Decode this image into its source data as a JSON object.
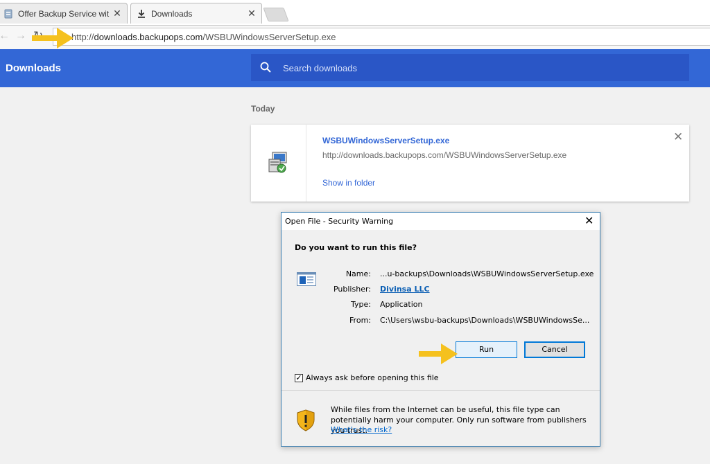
{
  "browser": {
    "tabs": [
      {
        "label": "Offer Backup Service wit",
        "icon": "page-icon",
        "active": false
      },
      {
        "label": "Downloads",
        "icon": "download-icon",
        "active": true
      }
    ],
    "url_prefix": "http://",
    "url_host": "downloads.backupops.com",
    "url_path": "/WSBUWindowsServerSetup.exe"
  },
  "downloads_page": {
    "title": "Downloads",
    "search_placeholder": "Search downloads",
    "date_heading": "Today",
    "item": {
      "file_name": "WSBUWindowsServerSetup.exe",
      "url": "http://downloads.backupops.com/WSBUWindowsServerSetup.exe",
      "action_label": "Show in folder"
    }
  },
  "dialog": {
    "title": "Open File - Security Warning",
    "question": "Do you want to run this file?",
    "fields": [
      {
        "label": "Name:",
        "value": "...u-backups\\Downloads\\WSBUWindowsServerSetup.exe"
      },
      {
        "label": "Publisher:",
        "value": "Divinsa LLC"
      },
      {
        "label": "Type:",
        "value": "Application"
      },
      {
        "label": "From:",
        "value": "C:\\Users\\wsbu-backups\\Downloads\\WSBUWindowsSe..."
      }
    ],
    "run_label": "Run",
    "cancel_label": "Cancel",
    "checkbox_label": "Always ask before opening this file",
    "checkbox_checked": true,
    "warning_text": "While files from the Internet can be useful, this file type can potentially harm your computer. Only run software from publishers you trust.",
    "risk_link": "What's the risk?"
  },
  "colors": {
    "header_blue": "#3367d6",
    "search_blue": "#2a56c6",
    "arrow_yellow": "#f5c11e"
  }
}
